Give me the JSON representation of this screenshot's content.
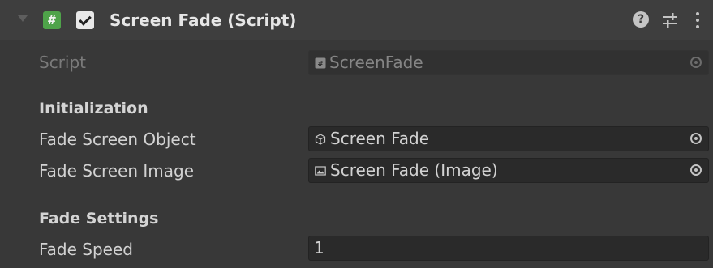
{
  "component": {
    "title": "Screen Fade (Script)",
    "script_icon_glyph": "#",
    "enabled": true
  },
  "header_icons": {
    "help_glyph": "?",
    "help": "help-icon",
    "presets": "presets-icon",
    "menu": "kebab-menu-icon"
  },
  "script_row": {
    "label": "Script",
    "value": "ScreenFade"
  },
  "sections": {
    "initialization": "Initialization",
    "fade_settings": "Fade Settings"
  },
  "fields": {
    "fade_screen_object": {
      "label": "Fade Screen Object",
      "value": "Screen Fade"
    },
    "fade_screen_image": {
      "label": "Fade Screen Image",
      "value": "Screen Fade (Image)"
    },
    "fade_speed": {
      "label": "Fade Speed",
      "value": "1"
    }
  },
  "colors": {
    "background": "#383838",
    "header": "#3e3e3e",
    "field": "#2a2a2a",
    "script_icon": "#4fa34a"
  }
}
